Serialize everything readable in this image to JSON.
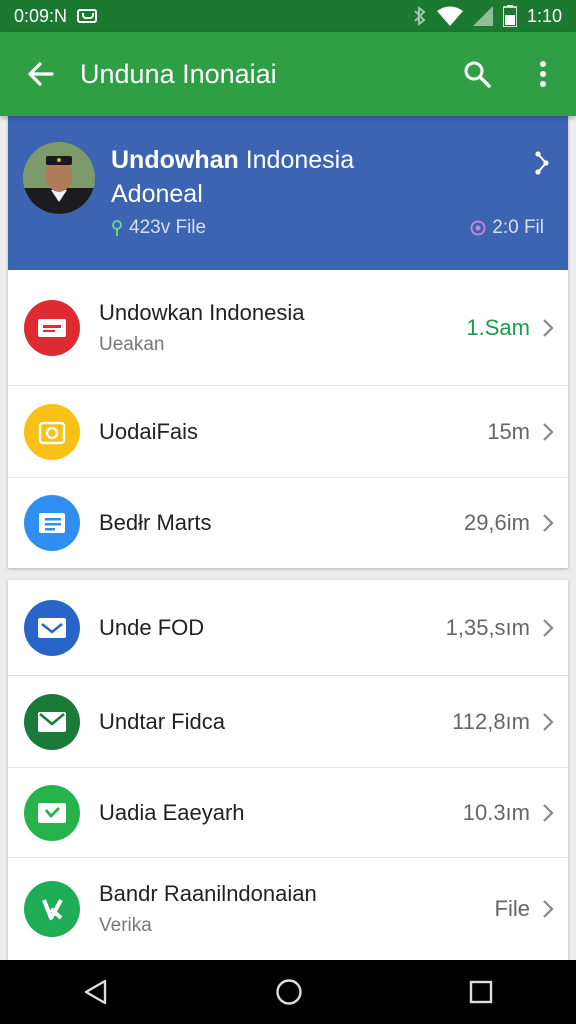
{
  "status": {
    "time": "0:09:N",
    "battery_time": "1:10"
  },
  "app_bar": {
    "title": "Unduna Inonaiai"
  },
  "profile": {
    "name_bold": "Undowhan",
    "name_rest": " Indonesia",
    "subtitle": "Adoneal",
    "left_stat": "423v File",
    "right_stat": "2:0 Fil"
  },
  "list1": [
    {
      "title": "Undowkan Indonesia",
      "subtitle": "Ueakan",
      "value": "1.Sam",
      "color": "#de2a31",
      "icon": "card-icon"
    },
    {
      "title": "UodaiFais",
      "value": "15m",
      "color": "#f9c015",
      "icon": "camera-icon"
    },
    {
      "title": "Bedłr Marts",
      "value": "29,6im",
      "color": "#2e8ff0",
      "icon": "list-icon"
    }
  ],
  "list2": [
    {
      "title": "Unde FOD",
      "value": "1,35,sım",
      "color": "#2965c9",
      "icon": "mail-icon"
    },
    {
      "title": "Undtar Fidca",
      "value": "112,8ım",
      "color": "#1b7a3a",
      "icon": "mail-icon"
    },
    {
      "title": "Uadia Eaeyarh",
      "value": "10.3ım",
      "color": "#27b34c",
      "icon": "check-mail-icon"
    },
    {
      "title": "Bandr Raanilndonaian",
      "subtitle": "Verika",
      "value": "File",
      "color": "#1ead55",
      "icon": "k-icon"
    }
  ],
  "colors": {
    "status_bar": "#1b7a2f",
    "app_bar": "#2f9e45",
    "profile_bg": "#3d64b3",
    "accent_green": "#1e9a4a"
  }
}
